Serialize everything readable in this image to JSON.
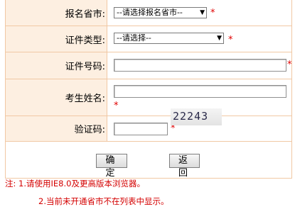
{
  "form": {
    "province": {
      "label": "报名省市:",
      "value": "--请选择报名省市--",
      "required": "*"
    },
    "id_type": {
      "label": "证件类型:",
      "value": "--请选择--",
      "required": "*"
    },
    "id_number": {
      "label": "证件号码:",
      "value": "",
      "required": "*"
    },
    "name": {
      "label": "考生姓名:",
      "value": "",
      "required": "*"
    },
    "captcha": {
      "label": "验证码:",
      "value": "",
      "required": "*",
      "image_text": "22243"
    }
  },
  "buttons": {
    "confirm": "确 定",
    "back": "返 回"
  },
  "notes": {
    "line1": "注: 1.请使用IE8.0及更高版本浏览器。",
    "line2": "2.当前未开通省市不在列表中显示。"
  },
  "colors": {
    "label_bg": "#fdefe1",
    "border": "#f1c8a4",
    "required": "#e00000"
  }
}
